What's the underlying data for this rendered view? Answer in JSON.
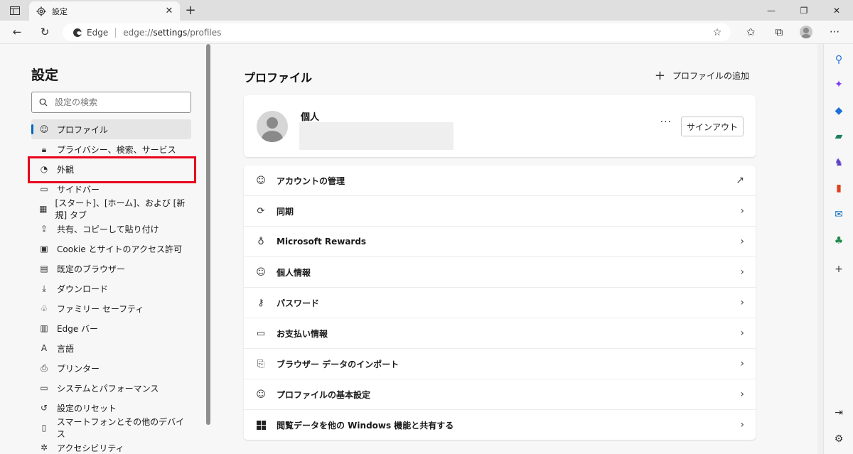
{
  "tab": {
    "title": "設定"
  },
  "toolbar": {
    "edge_label": "Edge",
    "url_prefix": "edge://",
    "url_host": "settings",
    "url_path": "/profiles"
  },
  "nav": {
    "title": "設定",
    "search_placeholder": "設定の検索",
    "items": [
      {
        "label": "プロファイル"
      },
      {
        "label": "プライバシー、検索、サービス"
      },
      {
        "label": "外観"
      },
      {
        "label": "サイドバー"
      },
      {
        "label": "[スタート]、[ホーム]、および [新規] タブ"
      },
      {
        "label": "共有、コピーして貼り付け"
      },
      {
        "label": "Cookie とサイトのアクセス許可"
      },
      {
        "label": "既定のブラウザー"
      },
      {
        "label": "ダウンロード"
      },
      {
        "label": "ファミリー セーフティ"
      },
      {
        "label": "Edge バー"
      },
      {
        "label": "言語"
      },
      {
        "label": "プリンター"
      },
      {
        "label": "システムとパフォーマンス"
      },
      {
        "label": "設定のリセット"
      },
      {
        "label": "スマートフォンとその他のデバイス"
      },
      {
        "label": "アクセシビリティ"
      }
    ]
  },
  "main": {
    "title": "プロファイル",
    "add_profile_label": "プロファイルの追加",
    "profile": {
      "name": "個人",
      "more_label": "···",
      "signout_label": "サインアウト"
    },
    "rows": [
      {
        "label": "アカウントの管理"
      },
      {
        "label": "同期"
      },
      {
        "label": "Microsoft Rewards"
      },
      {
        "label": "個人情報"
      },
      {
        "label": "パスワード"
      },
      {
        "label": "お支払い情報"
      },
      {
        "label": "ブラウザー データのインポート"
      },
      {
        "label": "プロファイルの基本設定"
      },
      {
        "label": "閲覧データを他の Windows 機能と共有する"
      }
    ]
  },
  "colors": {
    "highlight": "#e8001c",
    "accent": "#0067c0"
  }
}
